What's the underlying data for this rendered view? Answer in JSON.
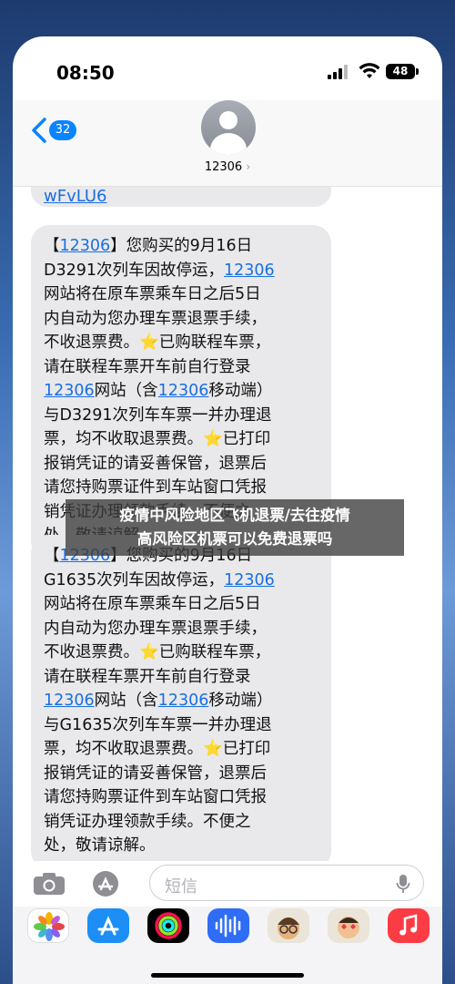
{
  "status": {
    "time": "08:50",
    "battery": "48"
  },
  "header": {
    "back_count": "32",
    "contact": "12306",
    "contact_chevron": "›"
  },
  "messages": {
    "previous_tail": "wFvLU6",
    "bubbles": [
      {
        "lines": [
          [
            "【",
            "12306",
            "】您购买的9月16日"
          ],
          [
            "D3291次列车因故停运，",
            "12306",
            ""
          ],
          [
            "网站将在原车票乘车日之后5日",
            "",
            ""
          ],
          [
            "内自动为您办理车票退票手续，",
            "",
            ""
          ],
          [
            "不收退票费。⭐已购联程车票，",
            "",
            ""
          ],
          [
            "请在联程车票开车前自行登录",
            "",
            ""
          ],
          [
            "",
            "12306",
            "网站（含"
          ],
          [
            "与D3291次列车车票一并办理退",
            "",
            ""
          ],
          [
            "票，均不收取退票费。⭐已打印",
            "",
            ""
          ],
          [
            "报销凭证的请妥善保管，退票后",
            "",
            ""
          ],
          [
            "请您持购票证件到车站窗口凭报",
            "",
            ""
          ],
          [
            "销凭证办理领款手续。不便之",
            "",
            ""
          ],
          [
            "处，敬请谅解。",
            "",
            ""
          ]
        ],
        "mobile_link": "12306",
        "mobile_suffix": "移动端）"
      },
      {
        "lines": [
          [
            "【",
            "12306",
            "】您购买的9月16日"
          ],
          [
            "G1635次列车因故停运，",
            "12306",
            ""
          ],
          [
            "网站将在原车票乘车日之后5日",
            "",
            ""
          ],
          [
            "内自动为您办理车票退票手续，",
            "",
            ""
          ],
          [
            "不收退票费。⭐已购联程车票，",
            "",
            ""
          ],
          [
            "请在联程车票开车前自行登录",
            "",
            ""
          ],
          [
            "",
            "12306",
            "网站（含"
          ],
          [
            "与G1635次列车车票一并办理退",
            "",
            ""
          ],
          [
            "票，均不收取退票费。⭐已打印",
            "",
            ""
          ],
          [
            "报销凭证的请妥善保管，退票后",
            "",
            ""
          ],
          [
            "请您持购票证件到车站窗口凭报",
            "",
            ""
          ],
          [
            "销凭证办理领款手续。不便之",
            "",
            ""
          ],
          [
            "处，敬请谅解。",
            "",
            ""
          ]
        ],
        "mobile_link": "12306",
        "mobile_suffix": "移动端）"
      }
    ]
  },
  "overlay": {
    "line1": "疫情中风险地区飞机退票/去往疫情",
    "line2": "高风险区机票可以免费退票吗"
  },
  "input": {
    "placeholder": "短信"
  },
  "apps": [
    "photos-icon",
    "appstore-icon",
    "fitness-icon",
    "audio-icon",
    "memoji-icon",
    "memoji2-icon",
    "music-icon"
  ],
  "colors": {
    "accent": "#0a84ff",
    "link": "#1a6fe0",
    "bubble": "#e9e9eb"
  }
}
